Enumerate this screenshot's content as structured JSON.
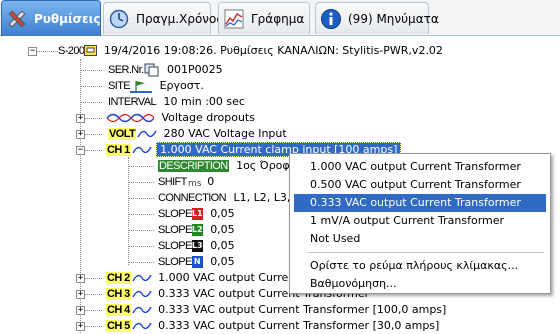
{
  "tabs": [
    {
      "label": "Ρυθμίσεις",
      "icon": "tools-icon",
      "active": true
    },
    {
      "label": "Πραγμ.Χρόνος",
      "icon": "clock-icon",
      "active": false
    },
    {
      "label": "Γράφημα",
      "icon": "chart-icon",
      "active": false
    },
    {
      "label": "(99) Μηνύματα",
      "icon": "info-icon",
      "active": false
    }
  ],
  "tree": {
    "root": {
      "prefix": "S-200",
      "text": "19/4/2016 19:08:26. Ρυθμίσεις ΚΑΝΑΛΙΩΝ: Stylitis-PWR,v2.02"
    },
    "sernr": {
      "prefix": "SER.Nr.",
      "text": "001P0025"
    },
    "site": {
      "prefix": "SITE",
      "text": "Εργοστ."
    },
    "interval": {
      "prefix": "INTERVAL",
      "text": "10 min :00 sec"
    },
    "voltage_dropouts": {
      "text": "Voltage dropouts"
    },
    "volt": {
      "prefix": "VOLT",
      "text": "280 VAC Voltage Input"
    },
    "ch1": {
      "prefix": "CH 1",
      "text": "1.000 VAC Current clamp input [100 amps]"
    },
    "description": {
      "prefix": "DESCRIPTION",
      "text": "1ος Όροφος"
    },
    "shift": {
      "prefix": "SHIFT",
      "text": "0"
    },
    "connection": {
      "prefix": "CONNECTION",
      "text": "L1, L2, L3, N"
    },
    "slopes": [
      {
        "prefix": "SLOPE",
        "badge": "L1",
        "color": "#d42020",
        "text": "0,05"
      },
      {
        "prefix": "SLOPE",
        "badge": "L2",
        "color": "#1f8a1f",
        "text": "0,05"
      },
      {
        "prefix": "SLOPE",
        "badge": "L3",
        "color": "#111111",
        "text": "0,05"
      },
      {
        "prefix": "SLOPE",
        "badge": "N",
        "color": "#1a4fd6",
        "text": "0,05"
      }
    ],
    "ch2": {
      "prefix": "CH 2",
      "text": "1.000 VAC output Current Transformer"
    },
    "ch3": {
      "prefix": "CH 3",
      "text": "0.333 VAC output Current Transformer"
    },
    "ch4": {
      "prefix": "CH 4",
      "text": "0.333 VAC output Current Transformer [100,0 amps]"
    },
    "ch5": {
      "prefix": "CH 5",
      "text": "0.333 VAC output Current Transformer [30,0 amps]"
    }
  },
  "menu": {
    "items": [
      "1.000 VAC output Current Transformer",
      "0.500 VAC output Current Transformer",
      "0.333 VAC output Current Transformer",
      "1 mV/A output Current Transformer",
      "Not Used"
    ],
    "highlighted_index": 2,
    "extra": [
      "Ορίστε το ρεύμα πλήρους κλίμακας...",
      "Βαθμονόμηση..."
    ]
  },
  "colors": {
    "accent": "#316ac5",
    "tab_active": "#3d7fcf",
    "prefix_highlight": "#ffff66"
  }
}
